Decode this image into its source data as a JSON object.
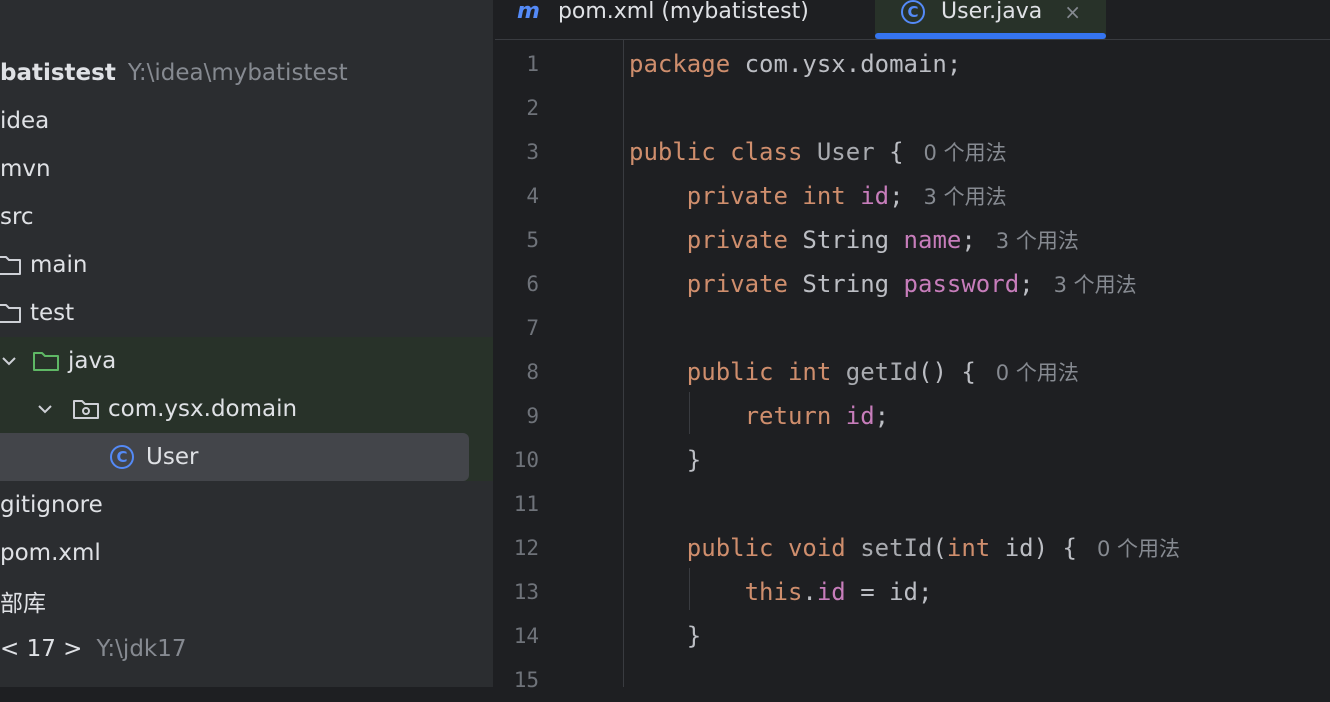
{
  "project_tree": [
    {
      "label": "batistest",
      "hint": "Y:\\idea\\mybatistest",
      "bold": true
    },
    {
      "label": "idea"
    },
    {
      "label": "mvn"
    },
    {
      "label": "src"
    },
    {
      "label": "main"
    },
    {
      "label": "test"
    },
    {
      "label": "java"
    },
    {
      "label": "com.ysx.domain"
    },
    {
      "label": "User",
      "class_badge": "C"
    },
    {
      "label": "gitignore"
    },
    {
      "label": "pom.xml"
    },
    {
      "label": "部库"
    },
    {
      "label": "< 17 >",
      "hint": "Y:\\jdk17"
    }
  ],
  "tabs": [
    {
      "label": "pom.xml (mybatistest)",
      "icon": "m"
    },
    {
      "label": "User.java",
      "badge": "C",
      "close": "×"
    }
  ],
  "editor": {
    "line_numbers": [
      "1",
      "2",
      "3",
      "4",
      "5",
      "6",
      "7",
      "8",
      "9",
      "10",
      "11",
      "12",
      "13",
      "14",
      "15"
    ],
    "lines": [
      [
        {
          "t": "package ",
          "c": "kw"
        },
        {
          "t": "com.ysx.domain;"
        }
      ],
      [],
      [
        {
          "t": "public class ",
          "c": "kw"
        },
        {
          "t": "User",
          "c": "plain-dim"
        },
        {
          "t": " {"
        },
        {
          "t": "0 个用法",
          "c": "hint"
        }
      ],
      [
        {
          "t": "    "
        },
        {
          "t": "private int ",
          "c": "kw"
        },
        {
          "t": "id",
          "c": "fld"
        },
        {
          "t": ";"
        },
        {
          "t": "3 个用法",
          "c": "hint"
        }
      ],
      [
        {
          "t": "    "
        },
        {
          "t": "private ",
          "c": "kw"
        },
        {
          "t": "String "
        },
        {
          "t": "name",
          "c": "fld"
        },
        {
          "t": ";"
        },
        {
          "t": "3 个用法",
          "c": "hint"
        }
      ],
      [
        {
          "t": "    "
        },
        {
          "t": "private ",
          "c": "kw"
        },
        {
          "t": "String "
        },
        {
          "t": "password",
          "c": "fld"
        },
        {
          "t": ";"
        },
        {
          "t": "3 个用法",
          "c": "hint"
        }
      ],
      [],
      [
        {
          "t": "    "
        },
        {
          "t": "public int ",
          "c": "kw"
        },
        {
          "t": "getId",
          "c": "plain-dim"
        },
        {
          "t": "() {"
        },
        {
          "t": "0 个用法",
          "c": "hint"
        }
      ],
      [
        {
          "t": "        "
        },
        {
          "t": "return ",
          "c": "kw"
        },
        {
          "t": "id",
          "c": "fld"
        },
        {
          "t": ";"
        }
      ],
      [
        {
          "t": "    }"
        }
      ],
      [],
      [
        {
          "t": "    "
        },
        {
          "t": "public void ",
          "c": "kw"
        },
        {
          "t": "setId",
          "c": "plain-dim"
        },
        {
          "t": "("
        },
        {
          "t": "int ",
          "c": "kw"
        },
        {
          "t": "id) {"
        },
        {
          "t": "0 个用法",
          "c": "hint"
        }
      ],
      [
        {
          "t": "        "
        },
        {
          "t": "this",
          "c": "kw"
        },
        {
          "t": "."
        },
        {
          "t": "id",
          "c": "fld"
        },
        {
          "t": " = id;"
        }
      ],
      [
        {
          "t": "    }"
        }
      ],
      []
    ]
  }
}
